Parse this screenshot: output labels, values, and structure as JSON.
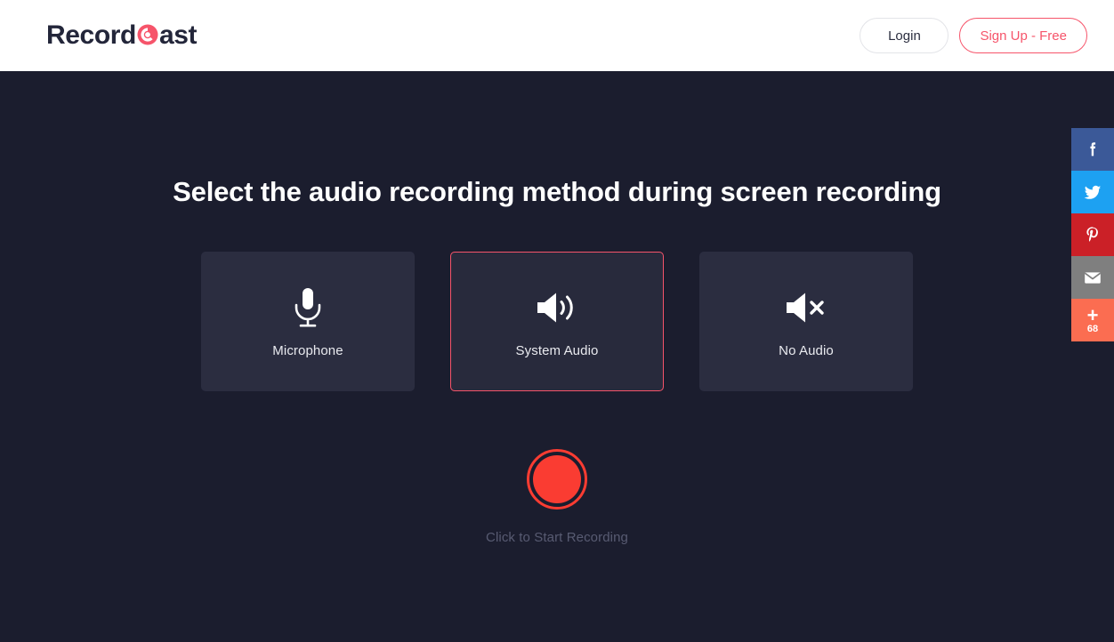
{
  "brand": {
    "name_prefix": "Record",
    "name_middle": "C",
    "name_suffix": "ast",
    "accent_color": "#f6546a",
    "logo_icon": "record-circle-icon"
  },
  "header": {
    "login_label": "Login",
    "signup_label": "Sign Up - Free",
    "background_color": "#ffffff"
  },
  "main": {
    "headline": "Select the audio recording method during screen recording",
    "background_color": "#1b1d2e",
    "options": [
      {
        "id": "microphone",
        "label": "Microphone",
        "icon": "microphone-icon",
        "selected": false
      },
      {
        "id": "system-audio",
        "label": "System Audio",
        "icon": "speaker-volume-icon",
        "selected": true
      },
      {
        "id": "no-audio",
        "label": "No Audio",
        "icon": "speaker-mute-icon",
        "selected": false
      }
    ],
    "record": {
      "caption": "Click to Start Recording",
      "button_color": "#fa3c32",
      "icon": "record-button-icon"
    }
  },
  "share_rail": {
    "items": [
      {
        "id": "facebook",
        "icon": "facebook-icon",
        "color": "#3b5998",
        "label": ""
      },
      {
        "id": "twitter",
        "icon": "twitter-icon",
        "color": "#1da1f2",
        "label": ""
      },
      {
        "id": "pinterest",
        "icon": "pinterest-icon",
        "color": "#cb2027",
        "label": ""
      },
      {
        "id": "email",
        "icon": "email-icon",
        "color": "#7f7f7f",
        "label": ""
      }
    ],
    "more": {
      "id": "share-more",
      "icon": "plus-icon",
      "color": "#fb6d51",
      "plus": "+",
      "count": "68"
    }
  }
}
